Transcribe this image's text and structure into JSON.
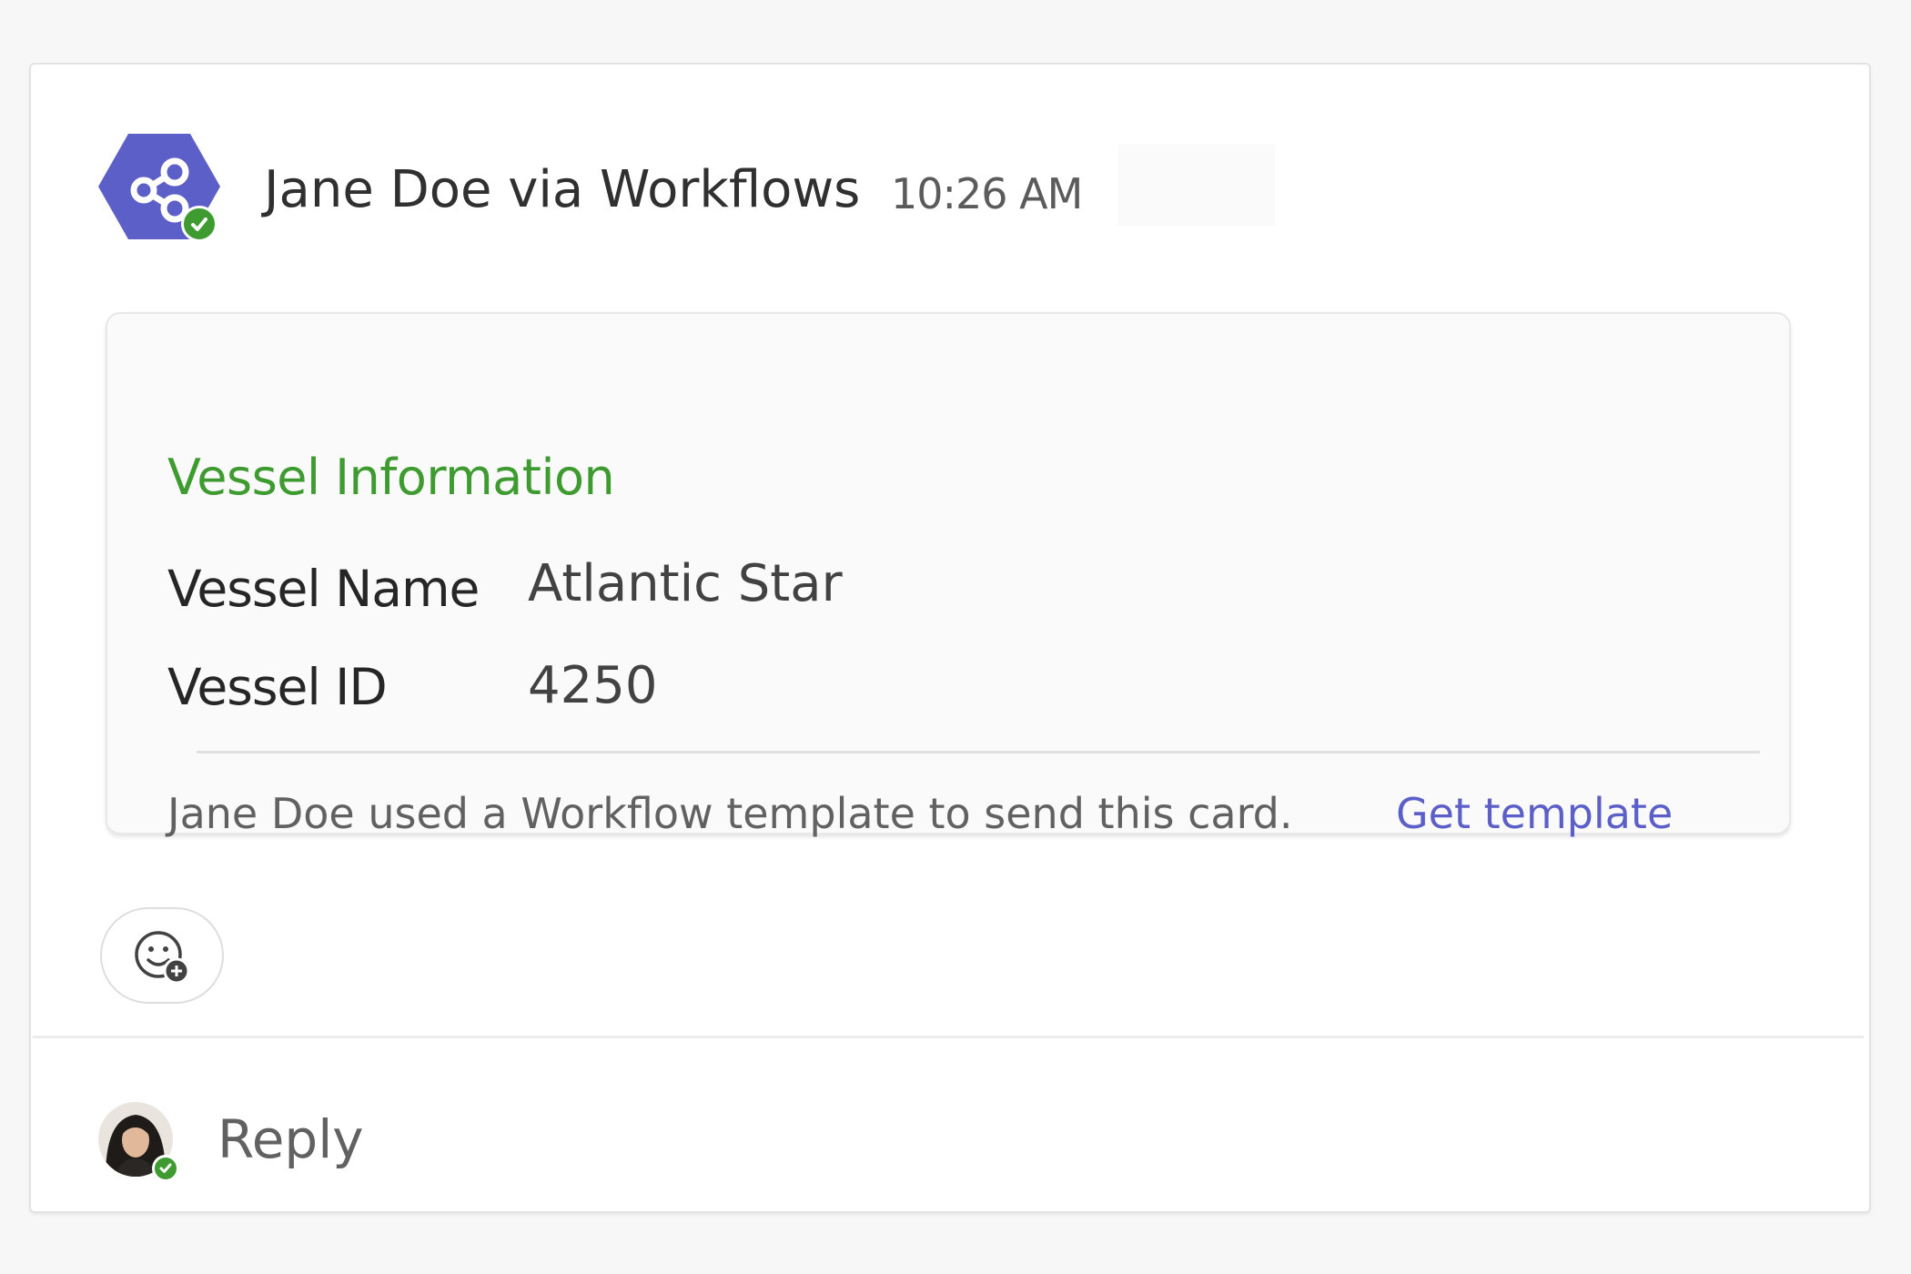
{
  "message": {
    "sender": "Jane Doe via Workflows",
    "timestamp": "10:26 AM",
    "bot_avatar_icon": "workflow-share-icon",
    "presence_color": "#3e9b30"
  },
  "card": {
    "title": "Vessel Information",
    "title_color": "#3e9b30",
    "facts": [
      {
        "label": "Vessel Name",
        "value": "Atlantic Star"
      },
      {
        "label": "Vessel ID",
        "value": "4250"
      }
    ],
    "footer_text": "Jane Doe used a Workflow template to send this card.",
    "footer_link": "Get template",
    "link_color": "#5b5fc7"
  },
  "reactions": {
    "add_reaction_icon": "emoji-add-icon"
  },
  "reply": {
    "placeholder": "Reply",
    "avatar_icon": "user-avatar"
  }
}
